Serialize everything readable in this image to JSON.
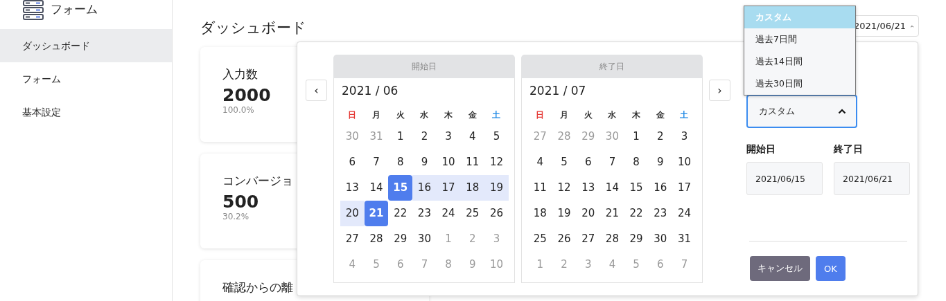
{
  "sidebar": {
    "logo_text": "フォーム",
    "items": [
      {
        "label": "ダッシュボード",
        "selected": true
      },
      {
        "label": "フォーム",
        "selected": false
      },
      {
        "label": "基本設定",
        "selected": false
      }
    ]
  },
  "page_title": "ダッシュボード",
  "cards": [
    {
      "label": "入力数",
      "value": "2000",
      "percent": "100.0%"
    },
    {
      "label": "コンバージョ",
      "value": "500",
      "percent": "30.2%"
    },
    {
      "label": "確認からの離"
    }
  ],
  "range_trigger": {
    "value": "2021/06/21"
  },
  "picker": {
    "prev": "‹",
    "next": "›",
    "calendars": [
      {
        "header": "開始日",
        "month": "2021 / 06",
        "weekdays": [
          {
            "label": "日",
            "color": "#e53935"
          },
          {
            "label": "月",
            "color": "#333333"
          },
          {
            "label": "火",
            "color": "#333333"
          },
          {
            "label": "水",
            "color": "#333333"
          },
          {
            "label": "木",
            "color": "#333333"
          },
          {
            "label": "金",
            "color": "#333333"
          },
          {
            "label": "土",
            "color": "#1e88e5"
          }
        ],
        "weeks": [
          [
            {
              "d": "30",
              "outside": true,
              "in_range": false,
              "endpoint": false
            },
            {
              "d": "31",
              "outside": true,
              "in_range": false,
              "endpoint": false
            },
            {
              "d": "1",
              "outside": false,
              "in_range": false,
              "endpoint": false
            },
            {
              "d": "2",
              "outside": false,
              "in_range": false,
              "endpoint": false
            },
            {
              "d": "3",
              "outside": false,
              "in_range": false,
              "endpoint": false
            },
            {
              "d": "4",
              "outside": false,
              "in_range": false,
              "endpoint": false
            },
            {
              "d": "5",
              "outside": false,
              "in_range": false,
              "endpoint": false
            }
          ],
          [
            {
              "d": "6",
              "outside": false,
              "in_range": false,
              "endpoint": false
            },
            {
              "d": "7",
              "outside": false,
              "in_range": false,
              "endpoint": false
            },
            {
              "d": "8",
              "outside": false,
              "in_range": false,
              "endpoint": false
            },
            {
              "d": "9",
              "outside": false,
              "in_range": false,
              "endpoint": false
            },
            {
              "d": "10",
              "outside": false,
              "in_range": false,
              "endpoint": false
            },
            {
              "d": "11",
              "outside": false,
              "in_range": false,
              "endpoint": false
            },
            {
              "d": "12",
              "outside": false,
              "in_range": false,
              "endpoint": false
            }
          ],
          [
            {
              "d": "13",
              "outside": false,
              "in_range": false,
              "endpoint": false
            },
            {
              "d": "14",
              "outside": false,
              "in_range": false,
              "endpoint": false
            },
            {
              "d": "15",
              "outside": false,
              "in_range": true,
              "endpoint": true
            },
            {
              "d": "16",
              "outside": false,
              "in_range": true,
              "endpoint": false
            },
            {
              "d": "17",
              "outside": false,
              "in_range": true,
              "endpoint": false
            },
            {
              "d": "18",
              "outside": false,
              "in_range": true,
              "endpoint": false
            },
            {
              "d": "19",
              "outside": false,
              "in_range": true,
              "endpoint": false
            }
          ],
          [
            {
              "d": "20",
              "outside": false,
              "in_range": true,
              "endpoint": false
            },
            {
              "d": "21",
              "outside": false,
              "in_range": true,
              "endpoint": true
            },
            {
              "d": "22",
              "outside": false,
              "in_range": false,
              "endpoint": false
            },
            {
              "d": "23",
              "outside": false,
              "in_range": false,
              "endpoint": false
            },
            {
              "d": "24",
              "outside": false,
              "in_range": false,
              "endpoint": false
            },
            {
              "d": "25",
              "outside": false,
              "in_range": false,
              "endpoint": false
            },
            {
              "d": "26",
              "outside": false,
              "in_range": false,
              "endpoint": false
            }
          ],
          [
            {
              "d": "27",
              "outside": false,
              "in_range": false,
              "endpoint": false
            },
            {
              "d": "28",
              "outside": false,
              "in_range": false,
              "endpoint": false
            },
            {
              "d": "29",
              "outside": false,
              "in_range": false,
              "endpoint": false
            },
            {
              "d": "30",
              "outside": false,
              "in_range": false,
              "endpoint": false
            },
            {
              "d": "1",
              "outside": true,
              "in_range": false,
              "endpoint": false
            },
            {
              "d": "2",
              "outside": true,
              "in_range": false,
              "endpoint": false
            },
            {
              "d": "3",
              "outside": true,
              "in_range": false,
              "endpoint": false
            }
          ],
          [
            {
              "d": "4",
              "outside": true,
              "in_range": false,
              "endpoint": false
            },
            {
              "d": "5",
              "outside": true,
              "in_range": false,
              "endpoint": false
            },
            {
              "d": "6",
              "outside": true,
              "in_range": false,
              "endpoint": false
            },
            {
              "d": "7",
              "outside": true,
              "in_range": false,
              "endpoint": false
            },
            {
              "d": "8",
              "outside": true,
              "in_range": false,
              "endpoint": false
            },
            {
              "d": "9",
              "outside": true,
              "in_range": false,
              "endpoint": false
            },
            {
              "d": "10",
              "outside": true,
              "in_range": false,
              "endpoint": false
            }
          ]
        ]
      },
      {
        "header": "終了日",
        "month": "2021 / 07",
        "weekdays": [
          {
            "label": "日",
            "color": "#e53935"
          },
          {
            "label": "月",
            "color": "#333333"
          },
          {
            "label": "火",
            "color": "#333333"
          },
          {
            "label": "水",
            "color": "#333333"
          },
          {
            "label": "木",
            "color": "#333333"
          },
          {
            "label": "金",
            "color": "#333333"
          },
          {
            "label": "土",
            "color": "#1e88e5"
          }
        ],
        "weeks": [
          [
            {
              "d": "27",
              "outside": true,
              "in_range": false,
              "endpoint": false
            },
            {
              "d": "28",
              "outside": true,
              "in_range": false,
              "endpoint": false
            },
            {
              "d": "29",
              "outside": true,
              "in_range": false,
              "endpoint": false
            },
            {
              "d": "30",
              "outside": true,
              "in_range": false,
              "endpoint": false
            },
            {
              "d": "1",
              "outside": false,
              "in_range": false,
              "endpoint": false
            },
            {
              "d": "2",
              "outside": false,
              "in_range": false,
              "endpoint": false
            },
            {
              "d": "3",
              "outside": false,
              "in_range": false,
              "endpoint": false
            }
          ],
          [
            {
              "d": "4",
              "outside": false,
              "in_range": false,
              "endpoint": false
            },
            {
              "d": "5",
              "outside": false,
              "in_range": false,
              "endpoint": false
            },
            {
              "d": "6",
              "outside": false,
              "in_range": false,
              "endpoint": false
            },
            {
              "d": "7",
              "outside": false,
              "in_range": false,
              "endpoint": false
            },
            {
              "d": "8",
              "outside": false,
              "in_range": false,
              "endpoint": false
            },
            {
              "d": "9",
              "outside": false,
              "in_range": false,
              "endpoint": false
            },
            {
              "d": "10",
              "outside": false,
              "in_range": false,
              "endpoint": false
            }
          ],
          [
            {
              "d": "11",
              "outside": false,
              "in_range": false,
              "endpoint": false
            },
            {
              "d": "12",
              "outside": false,
              "in_range": false,
              "endpoint": false
            },
            {
              "d": "13",
              "outside": false,
              "in_range": false,
              "endpoint": false
            },
            {
              "d": "14",
              "outside": false,
              "in_range": false,
              "endpoint": false
            },
            {
              "d": "15",
              "outside": false,
              "in_range": false,
              "endpoint": false
            },
            {
              "d": "16",
              "outside": false,
              "in_range": false,
              "endpoint": false
            },
            {
              "d": "17",
              "outside": false,
              "in_range": false,
              "endpoint": false
            }
          ],
          [
            {
              "d": "18",
              "outside": false,
              "in_range": false,
              "endpoint": false
            },
            {
              "d": "19",
              "outside": false,
              "in_range": false,
              "endpoint": false
            },
            {
              "d": "20",
              "outside": false,
              "in_range": false,
              "endpoint": false
            },
            {
              "d": "21",
              "outside": false,
              "in_range": false,
              "endpoint": false
            },
            {
              "d": "22",
              "outside": false,
              "in_range": false,
              "endpoint": false
            },
            {
              "d": "23",
              "outside": false,
              "in_range": false,
              "endpoint": false
            },
            {
              "d": "24",
              "outside": false,
              "in_range": false,
              "endpoint": false
            }
          ],
          [
            {
              "d": "25",
              "outside": false,
              "in_range": false,
              "endpoint": false
            },
            {
              "d": "26",
              "outside": false,
              "in_range": false,
              "endpoint": false
            },
            {
              "d": "27",
              "outside": false,
              "in_range": false,
              "endpoint": false
            },
            {
              "d": "28",
              "outside": false,
              "in_range": false,
              "endpoint": false
            },
            {
              "d": "29",
              "outside": false,
              "in_range": false,
              "endpoint": false
            },
            {
              "d": "30",
              "outside": false,
              "in_range": false,
              "endpoint": false
            },
            {
              "d": "31",
              "outside": false,
              "in_range": false,
              "endpoint": false
            }
          ],
          [
            {
              "d": "1",
              "outside": true,
              "in_range": false,
              "endpoint": false
            },
            {
              "d": "2",
              "outside": true,
              "in_range": false,
              "endpoint": false
            },
            {
              "d": "3",
              "outside": true,
              "in_range": false,
              "endpoint": false
            },
            {
              "d": "4",
              "outside": true,
              "in_range": false,
              "endpoint": false
            },
            {
              "d": "5",
              "outside": true,
              "in_range": false,
              "endpoint": false
            },
            {
              "d": "6",
              "outside": true,
              "in_range": false,
              "endpoint": false
            },
            {
              "d": "7",
              "outside": true,
              "in_range": false,
              "endpoint": false
            }
          ]
        ]
      }
    ],
    "preset_select": {
      "value": "カスタム",
      "expanded": true
    },
    "preset_options": [
      {
        "label": "カスタム",
        "selected": true
      },
      {
        "label": "過去7日間",
        "selected": false
      },
      {
        "label": "過去14日間",
        "selected": false
      },
      {
        "label": "過去30日間",
        "selected": false
      }
    ],
    "start_label": "開始日",
    "start_value": "2021/06/15",
    "end_label": "終了日",
    "end_value": "2021/06/21",
    "cancel": "キャンセル",
    "ok": "OK"
  }
}
